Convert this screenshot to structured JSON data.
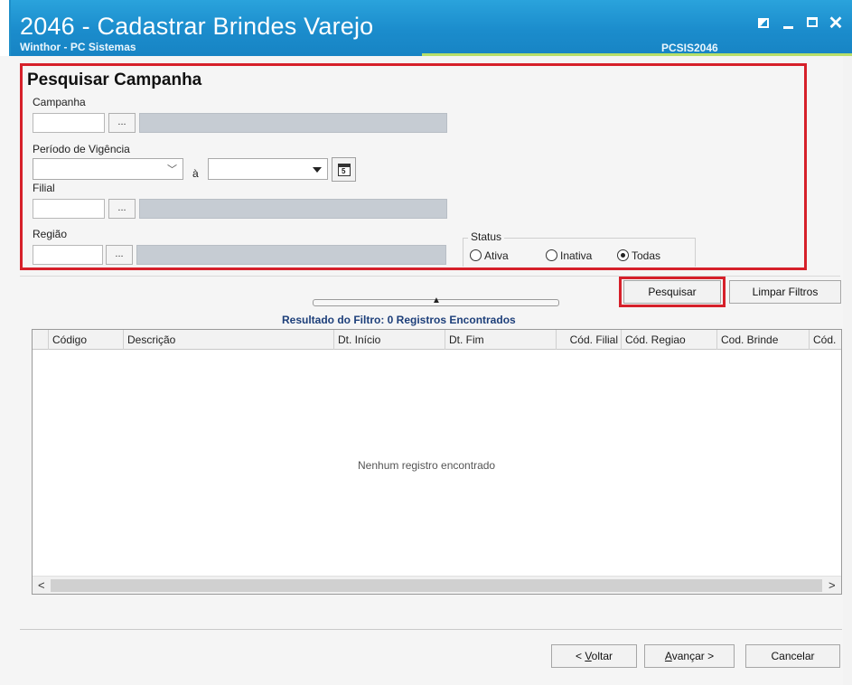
{
  "window": {
    "title": "2046 - Cadastrar Brindes Varejo",
    "subtitle": "Winthor - PC Sistemas",
    "code": "PCSIS2046"
  },
  "search": {
    "title": "Pesquisar Campanha",
    "campanha_label": "Campanha",
    "periodo_label": "Período de Vigência",
    "a_label": "à",
    "filial_label": "Filial",
    "regiao_label": "Região",
    "ellipsis": "...",
    "status_label": "Status",
    "status_options": [
      "Ativa",
      "Inativa",
      "Todas"
    ],
    "status_selected": "Todas",
    "calendar_number": "5"
  },
  "buttons": {
    "pesquisar": "Pesquisar",
    "limpar": "Limpar Filtros",
    "voltar_u": "V",
    "voltar_rest": "oltar",
    "voltar_prefix": "< ",
    "avancar_u": "A",
    "avancar_rest": "vançar >",
    "cancelar": "Cancelar"
  },
  "results": {
    "label": "Resultado do Filtro: 0 Registros Encontrados",
    "empty_message": "Nenhum registro encontrado",
    "columns": [
      "Código",
      "Descrição",
      "Dt. Início",
      "Dt. Fim",
      "Cód. Filial",
      "Cód. Regiao",
      "Cod. Brinde",
      "Cód."
    ]
  },
  "colors": {
    "titlebar": "#1b8ccc",
    "highlight": "#d6202a",
    "result_label": "#1d3f7a"
  }
}
